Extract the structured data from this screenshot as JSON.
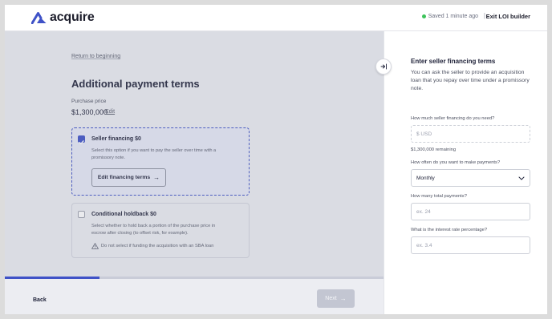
{
  "header": {
    "brand": "acquire",
    "save_status": "Saved 1 minute ago",
    "separator": "|",
    "exit_label": "Exit LOI builder",
    "colors": {
      "status_dot": "#3cc35a",
      "brand": "#3f52c7"
    }
  },
  "main": {
    "return_link": "Return to beginning",
    "title": "Additional payment terms",
    "purchase_price_label": "Purchase price",
    "purchase_price_value": "$1,300,000",
    "edit_label": "Edit",
    "options": [
      {
        "title": "Seller financing $0",
        "description": "Select this option if you want to pay the seller over time with a promissory note.",
        "checked": true,
        "button_label": "Edit financing terms",
        "button_icon": "arrow-right-icon"
      },
      {
        "title": "Conditional holdback $0",
        "description": "Select whether to hold back a portion of the purchase price in escrow after closing (to offset risk, for example).",
        "checked": false,
        "warning": "Do not select if funding the acquisition with an SBA loan",
        "warning_icon": "warning-triangle-icon"
      }
    ],
    "progress_fraction": 0.25
  },
  "footer": {
    "back_label": "Back",
    "next_label": "Next"
  },
  "panel": {
    "title": "Enter seller financing terms",
    "description": "You can ask the seller to provide an acquisition loan that you repay over time under a promissory note.",
    "fields": [
      {
        "label": "How much seller financing do you need?",
        "placeholder": "$ USD",
        "helper": "$1,300,000 remaining"
      },
      {
        "label": "How often do you want to make payments?",
        "value": "Monthly"
      },
      {
        "label": "How many total payments?",
        "placeholder": "ex. 24"
      },
      {
        "label": "What is the interest rate percentage?",
        "placeholder": "ex. 3.4"
      }
    ]
  }
}
